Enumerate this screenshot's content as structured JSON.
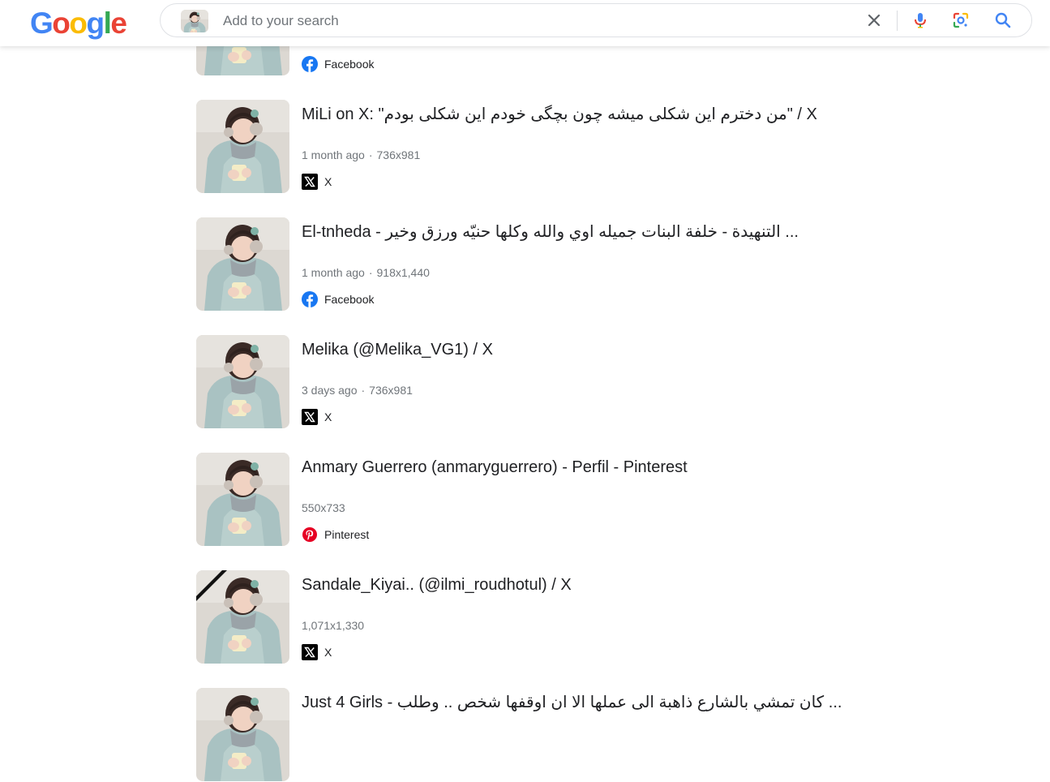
{
  "header": {
    "logo_text": "Google",
    "search": {
      "placeholder": "Add to your search",
      "value": ""
    },
    "icons": [
      "close-icon",
      "microphone-icon",
      "google-lens-icon",
      "search-icon"
    ]
  },
  "colors": {
    "facebook": "#1877F2",
    "x": "#000000",
    "pinterest": "#E60023",
    "google_blue": "#4285F4",
    "google_red": "#EA4335",
    "google_yellow": "#FBBC05",
    "google_green": "#34A853"
  },
  "results": [
    {
      "title": "",
      "date": "",
      "size": "",
      "source": "Facebook",
      "source_icon": "facebook-icon"
    },
    {
      "title": "MiLi on X: \"من دخترم این شکلی میشه چون بچگی خودم این شکلی بودم\" / X",
      "date": "1 month ago",
      "size": "736x981",
      "source": "X",
      "source_icon": "x-icon"
    },
    {
      "title": "El-tnheda - التنهيدة - خلفة البنات جميله اوي والله وكلها حنيّه ورزق وخير ...",
      "date": "1 month ago",
      "size": "918x1,440",
      "source": "Facebook",
      "source_icon": "facebook-icon"
    },
    {
      "title": "Melika (@Melika_VG1) / X",
      "date": "3 days ago",
      "size": "736x981",
      "source": "X",
      "source_icon": "x-icon"
    },
    {
      "title": "Anmary Guerrero (anmaryguerrero) - Perfil - Pinterest",
      "date": "",
      "size": "550x733",
      "source": "Pinterest",
      "source_icon": "pinterest-icon"
    },
    {
      "title": "Sandale_Kiyai.. (@ilmi_roudhotul) / X",
      "date": "",
      "size": "1,071x1,330",
      "source": "X",
      "source_icon": "x-icon"
    },
    {
      "title": "Just 4 Girls - كان تمشي بالشارع ذاهبة الى عملها الا ان اوقفها شخص .. وطلب ...",
      "date": "",
      "size": "",
      "source": "",
      "source_icon": ""
    }
  ]
}
